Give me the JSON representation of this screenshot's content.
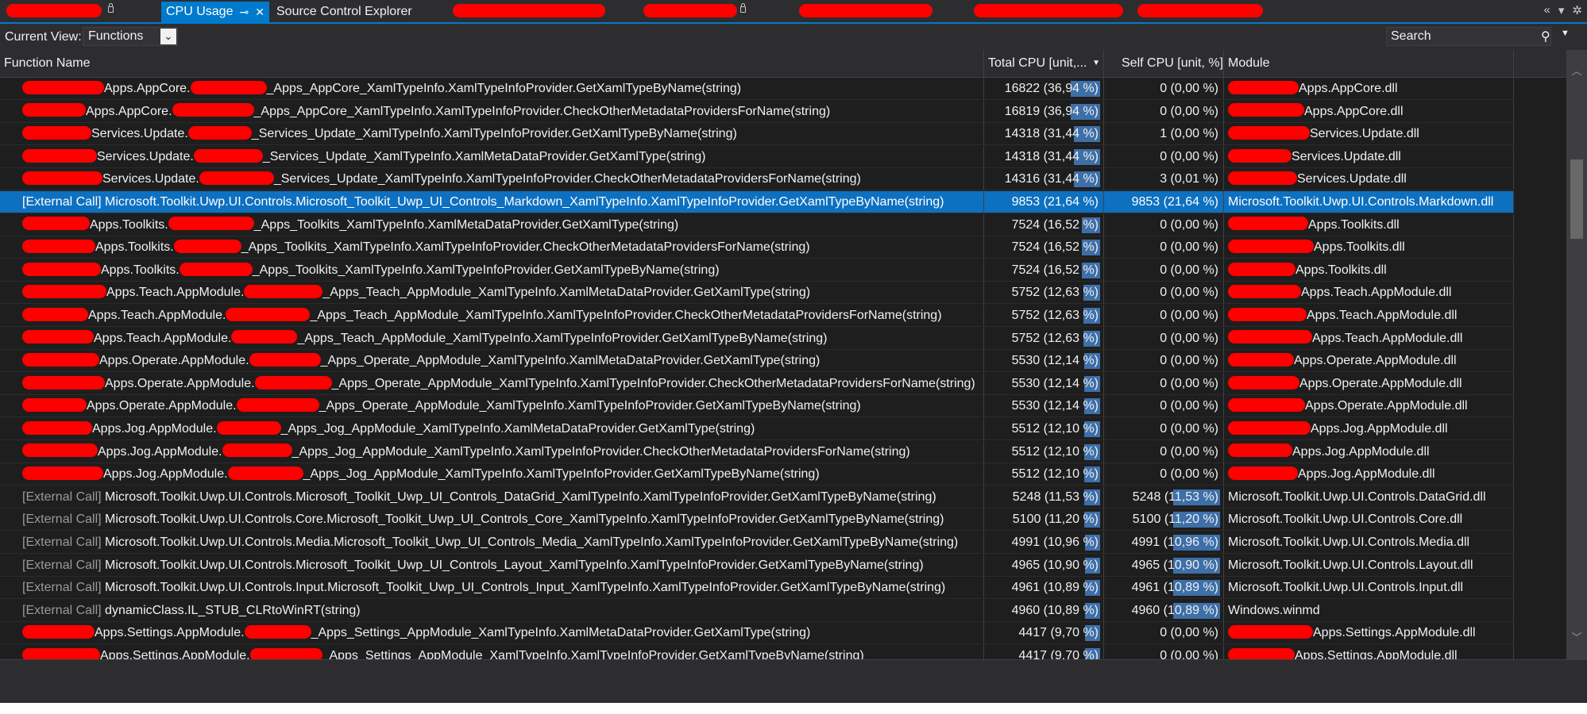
{
  "tabs": [
    {
      "label": "",
      "redacted": true,
      "locked": true
    },
    {
      "label": "CPU Usage",
      "active": true,
      "pin_icon": "pin-icon",
      "close_icon": "close-icon"
    },
    {
      "label": "Source Control Explorer"
    },
    {
      "label": "",
      "redacted": true
    },
    {
      "label": "",
      "redacted": true,
      "locked": true
    },
    {
      "label": "",
      "redacted": true
    },
    {
      "label": "",
      "redacted": true
    },
    {
      "label": "",
      "redacted": true
    }
  ],
  "toolbar": {
    "current_view_label": "Current View:",
    "current_view_value": "Functions",
    "search_placeholder": "Search"
  },
  "columns": {
    "function": "Function Name",
    "total": "Total CPU [unit,...",
    "self": "Self CPU [unit, %]",
    "module": "Module"
  },
  "colors": {
    "accent": "#007acc",
    "selected_row": "#0e70c0",
    "heat_bar": "#3d6fa8",
    "redaction": "#ff0000"
  },
  "rows": [
    {
      "fn_pre": "Apps.AppCore.",
      "fn_post": "_Apps_AppCore_XamlTypeInfo.XamlTypeInfoProvider.GetXamlTypeByName(string)",
      "total": "16822 (36,94 %)",
      "self": "0 (0,00 %)",
      "module": "Apps.AppCore.dll",
      "total_pct": 36.94,
      "self_pct": 0
    },
    {
      "fn_pre": "Apps.AppCore.",
      "fn_post": "_Apps_AppCore_XamlTypeInfo.XamlTypeInfoProvider.CheckOtherMetadataProvidersForName(string)",
      "total": "16819 (36,94 %)",
      "self": "0 (0,00 %)",
      "module": "Apps.AppCore.dll",
      "total_pct": 36.94,
      "self_pct": 0
    },
    {
      "fn_pre": "Services.Update.",
      "fn_post": "_Services_Update_XamlTypeInfo.XamlTypeInfoProvider.GetXamlTypeByName(string)",
      "total": "14318 (31,44 %)",
      "self": "1 (0,00 %)",
      "module": "Services.Update.dll",
      "total_pct": 31.44,
      "self_pct": 0
    },
    {
      "fn_pre": "Services.Update.",
      "fn_post": "_Services_Update_XamlTypeInfo.XamlMetaDataProvider.GetXamlType(string)",
      "total": "14318 (31,44 %)",
      "self": "0 (0,00 %)",
      "module": "Services.Update.dll",
      "total_pct": 31.44,
      "self_pct": 0
    },
    {
      "fn_pre": "Services.Update.",
      "fn_post": "_Services_Update_XamlTypeInfo.XamlTypeInfoProvider.CheckOtherMetadataProvidersForName(string)",
      "total": "14316 (31,44 %)",
      "self": "3 (0,01 %)",
      "module": "Services.Update.dll",
      "total_pct": 31.44,
      "self_pct": 0.01
    },
    {
      "external": true,
      "selected": true,
      "ext_label": "[External Call]",
      "fn_text": "Microsoft.Toolkit.Uwp.UI.Controls.Microsoft_Toolkit_Uwp_UI_Controls_Markdown_XamlTypeInfo.XamlTypeInfoProvider.GetXamlTypeByName(string)",
      "total": "9853 (21,64 %)",
      "self": "9853 (21,64 %)",
      "module": "Microsoft.Toolkit.Uwp.UI.Controls.Markdown.dll",
      "total_pct": 21.64,
      "self_pct": 21.64
    },
    {
      "fn_pre": "Apps.Toolkits.",
      "fn_post": "_Apps_Toolkits_XamlTypeInfo.XamlMetaDataProvider.GetXamlType(string)",
      "total": "7524 (16,52 %)",
      "self": "0 (0,00 %)",
      "module": "Apps.Toolkits.dll",
      "total_pct": 16.52,
      "self_pct": 0
    },
    {
      "fn_pre": "Apps.Toolkits.",
      "fn_post": "_Apps_Toolkits_XamlTypeInfo.XamlTypeInfoProvider.CheckOtherMetadataProvidersForName(string)",
      "total": "7524 (16,52 %)",
      "self": "0 (0,00 %)",
      "module": "Apps.Toolkits.dll",
      "total_pct": 16.52,
      "self_pct": 0
    },
    {
      "fn_pre": "Apps.Toolkits.",
      "fn_post": "_Apps_Toolkits_XamlTypeInfo.XamlTypeInfoProvider.GetXamlTypeByName(string)",
      "total": "7524 (16,52 %)",
      "self": "0 (0,00 %)",
      "module": "Apps.Toolkits.dll",
      "total_pct": 16.52,
      "self_pct": 0
    },
    {
      "fn_pre": "Apps.Teach.AppModule.",
      "fn_post": "_Apps_Teach_AppModule_XamlTypeInfo.XamlMetaDataProvider.GetXamlType(string)",
      "total": "5752 (12,63 %)",
      "self": "0 (0,00 %)",
      "module": "Apps.Teach.AppModule.dll",
      "total_pct": 12.63,
      "self_pct": 0
    },
    {
      "fn_pre": "Apps.Teach.AppModule.",
      "fn_post": "_Apps_Teach_AppModule_XamlTypeInfo.XamlTypeInfoProvider.CheckOtherMetadataProvidersForName(string)",
      "total": "5752 (12,63 %)",
      "self": "0 (0,00 %)",
      "module": "Apps.Teach.AppModule.dll",
      "total_pct": 12.63,
      "self_pct": 0
    },
    {
      "fn_pre": "Apps.Teach.AppModule.",
      "fn_post": "_Apps_Teach_AppModule_XamlTypeInfo.XamlTypeInfoProvider.GetXamlTypeByName(string)",
      "total": "5752 (12,63 %)",
      "self": "0 (0,00 %)",
      "module": "Apps.Teach.AppModule.dll",
      "total_pct": 12.63,
      "self_pct": 0
    },
    {
      "fn_pre": "Apps.Operate.AppModule.",
      "fn_post": "_Apps_Operate_AppModule_XamlTypeInfo.XamlMetaDataProvider.GetXamlType(string)",
      "total": "5530 (12,14 %)",
      "self": "0 (0,00 %)",
      "module": "Apps.Operate.AppModule.dll",
      "total_pct": 12.14,
      "self_pct": 0
    },
    {
      "fn_pre": "Apps.Operate.AppModule.",
      "fn_post": "_Apps_Operate_AppModule_XamlTypeInfo.XamlTypeInfoProvider.CheckOtherMetadataProvidersForName(string)",
      "total": "5530 (12,14 %)",
      "self": "0 (0,00 %)",
      "module": "Apps.Operate.AppModule.dll",
      "total_pct": 12.14,
      "self_pct": 0
    },
    {
      "fn_pre": "Apps.Operate.AppModule.",
      "fn_post": "_Apps_Operate_AppModule_XamlTypeInfo.XamlTypeInfoProvider.GetXamlTypeByName(string)",
      "total": "5530 (12,14 %)",
      "self": "0 (0,00 %)",
      "module": "Apps.Operate.AppModule.dll",
      "total_pct": 12.14,
      "self_pct": 0
    },
    {
      "fn_pre": "Apps.Jog.AppModule.",
      "fn_post": "_Apps_Jog_AppModule_XamlTypeInfo.XamlMetaDataProvider.GetXamlType(string)",
      "total": "5512 (12,10 %)",
      "self": "0 (0,00 %)",
      "module": "Apps.Jog.AppModule.dll",
      "total_pct": 12.1,
      "self_pct": 0
    },
    {
      "fn_pre": "Apps.Jog.AppModule.",
      "fn_post": "_Apps_Jog_AppModule_XamlTypeInfo.XamlTypeInfoProvider.CheckOtherMetadataProvidersForName(string)",
      "total": "5512 (12,10 %)",
      "self": "0 (0,00 %)",
      "module": "Apps.Jog.AppModule.dll",
      "total_pct": 12.1,
      "self_pct": 0
    },
    {
      "fn_pre": "Apps.Jog.AppModule.",
      "fn_post": "_Apps_Jog_AppModule_XamlTypeInfo.XamlTypeInfoProvider.GetXamlTypeByName(string)",
      "total": "5512 (12,10 %)",
      "self": "0 (0,00 %)",
      "module": "Apps.Jog.AppModule.dll",
      "total_pct": 12.1,
      "self_pct": 0
    },
    {
      "external": true,
      "ext_label": "[External Call]",
      "fn_text": "Microsoft.Toolkit.Uwp.UI.Controls.Microsoft_Toolkit_Uwp_UI_Controls_DataGrid_XamlTypeInfo.XamlTypeInfoProvider.GetXamlTypeByName(string)",
      "total": "5248 (11,53 %)",
      "self": "5248 (11,53 %)",
      "module": "Microsoft.Toolkit.Uwp.UI.Controls.DataGrid.dll",
      "total_pct": 11.53,
      "self_pct": 11.53
    },
    {
      "external": true,
      "ext_label": "[External Call]",
      "fn_text": "Microsoft.Toolkit.Uwp.UI.Controls.Core.Microsoft_Toolkit_Uwp_UI_Controls_Core_XamlTypeInfo.XamlTypeInfoProvider.GetXamlTypeByName(string)",
      "total": "5100 (11,20 %)",
      "self": "5100 (11,20 %)",
      "module": "Microsoft.Toolkit.Uwp.UI.Controls.Core.dll",
      "total_pct": 11.2,
      "self_pct": 11.2
    },
    {
      "external": true,
      "ext_label": "[External Call]",
      "fn_text": "Microsoft.Toolkit.Uwp.UI.Controls.Media.Microsoft_Toolkit_Uwp_UI_Controls_Media_XamlTypeInfo.XamlTypeInfoProvider.GetXamlTypeByName(string)",
      "total": "4991 (10,96 %)",
      "self": "4991 (10,96 %)",
      "module": "Microsoft.Toolkit.Uwp.UI.Controls.Media.dll",
      "total_pct": 10.96,
      "self_pct": 10.96
    },
    {
      "external": true,
      "ext_label": "[External Call]",
      "fn_text": "Microsoft.Toolkit.Uwp.UI.Controls.Microsoft_Toolkit_Uwp_UI_Controls_Layout_XamlTypeInfo.XamlTypeInfoProvider.GetXamlTypeByName(string)",
      "total": "4965 (10,90 %)",
      "self": "4965 (10,90 %)",
      "module": "Microsoft.Toolkit.Uwp.UI.Controls.Layout.dll",
      "total_pct": 10.9,
      "self_pct": 10.9
    },
    {
      "external": true,
      "ext_label": "[External Call]",
      "fn_text": "Microsoft.Toolkit.Uwp.UI.Controls.Input.Microsoft_Toolkit_Uwp_UI_Controls_Input_XamlTypeInfo.XamlTypeInfoProvider.GetXamlTypeByName(string)",
      "total": "4961 (10,89 %)",
      "self": "4961 (10,89 %)",
      "module": "Microsoft.Toolkit.Uwp.UI.Controls.Input.dll",
      "total_pct": 10.89,
      "self_pct": 10.89
    },
    {
      "external": true,
      "ext_label": "[External Call]",
      "fn_text": "dynamicClass.IL_STUB_CLRtoWinRT(string)",
      "total": "4960 (10,89 %)",
      "self": "4960 (10,89 %)",
      "module": "Windows.winmd",
      "total_pct": 10.89,
      "self_pct": 10.89
    },
    {
      "fn_pre": "Apps.Settings.AppModule.",
      "fn_post": "_Apps_Settings_AppModule_XamlTypeInfo.XamlMetaDataProvider.GetXamlType(string)",
      "total": "4417 (9,70 %)",
      "self": "0 (0,00 %)",
      "module": "Apps.Settings.AppModule.dll",
      "total_pct": 9.7,
      "self_pct": 0
    },
    {
      "fn_pre": "Apps.Settings.AppModule.",
      "fn_post": "_Apps_Settings_AppModule_XamlTypeInfo.XamlTypeInfoProvider.GetXamlTypeByName(string)",
      "total": "4417 (9,70 %)",
      "self": "0 (0,00 %)",
      "module": "Apps.Settings.AppModule.dll",
      "total_pct": 9.7,
      "self_pct": 0
    }
  ]
}
